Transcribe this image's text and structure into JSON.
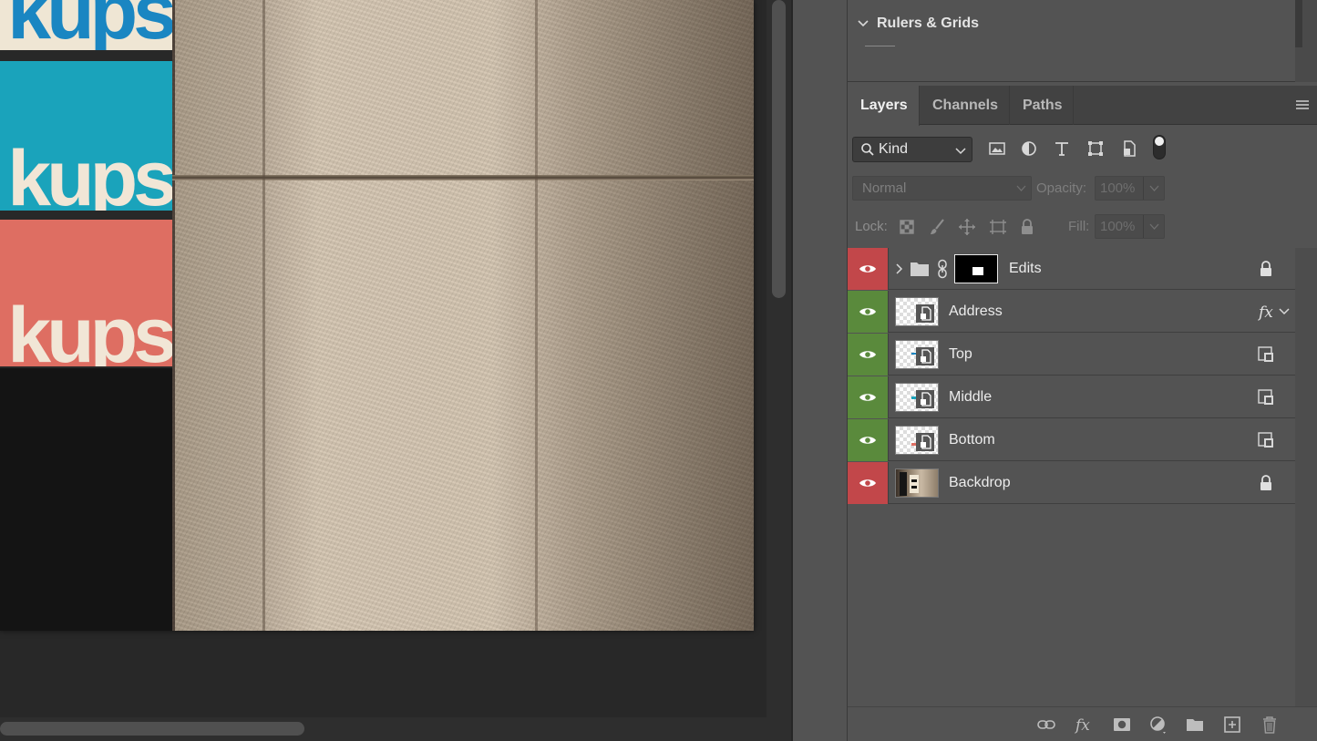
{
  "canvas": {
    "card_texts": [
      "kups",
      "kups",
      "kups"
    ]
  },
  "rulers_panel": {
    "title": "Rulers & Grids"
  },
  "layers_panel": {
    "tabs": [
      {
        "label": "Layers",
        "active": true
      },
      {
        "label": "Channels",
        "active": false
      },
      {
        "label": "Paths",
        "active": false
      }
    ],
    "filter": {
      "kind_label": "Kind",
      "icons": [
        "image-filter-icon",
        "adjustment-filter-icon",
        "type-filter-icon",
        "shape-filter-icon",
        "smart-object-filter-icon"
      ]
    },
    "blend_mode": "Normal",
    "opacity_label": "Opacity:",
    "opacity_value": "100%",
    "lock_label": "Lock:",
    "fill_label": "Fill:",
    "fill_value": "100%",
    "layers": [
      {
        "name": "Edits",
        "eye_color": "#c2474a",
        "type": "group",
        "right_icon": "lock-icon"
      },
      {
        "name": "Address",
        "eye_color": "#5a8a3c",
        "type": "smart-object",
        "right_icon": "fx-icon"
      },
      {
        "name": "Top",
        "eye_color": "#5a8a3c",
        "type": "smart-object",
        "right_icon": "smart-object-icon"
      },
      {
        "name": "Middle",
        "eye_color": "#5a8a3c",
        "type": "smart-object",
        "right_icon": "smart-object-icon"
      },
      {
        "name": "Bottom",
        "eye_color": "#5a8a3c",
        "type": "smart-object",
        "right_icon": "smart-object-icon"
      },
      {
        "name": "Backdrop",
        "eye_color": "#c2474a",
        "type": "image",
        "right_icon": "lock-icon"
      }
    ],
    "footer_icons": [
      "link-layers-icon",
      "fx-icon",
      "add-mask-icon",
      "adjustment-layer-icon",
      "new-group-icon",
      "new-layer-icon",
      "trash-icon"
    ]
  },
  "colors": {
    "eye_red": "#c2474a",
    "eye_green": "#5a8a3c",
    "card_blue_text": "#1a86c2",
    "card_teal": "#1aa3bb",
    "card_coral": "#de6e62"
  }
}
